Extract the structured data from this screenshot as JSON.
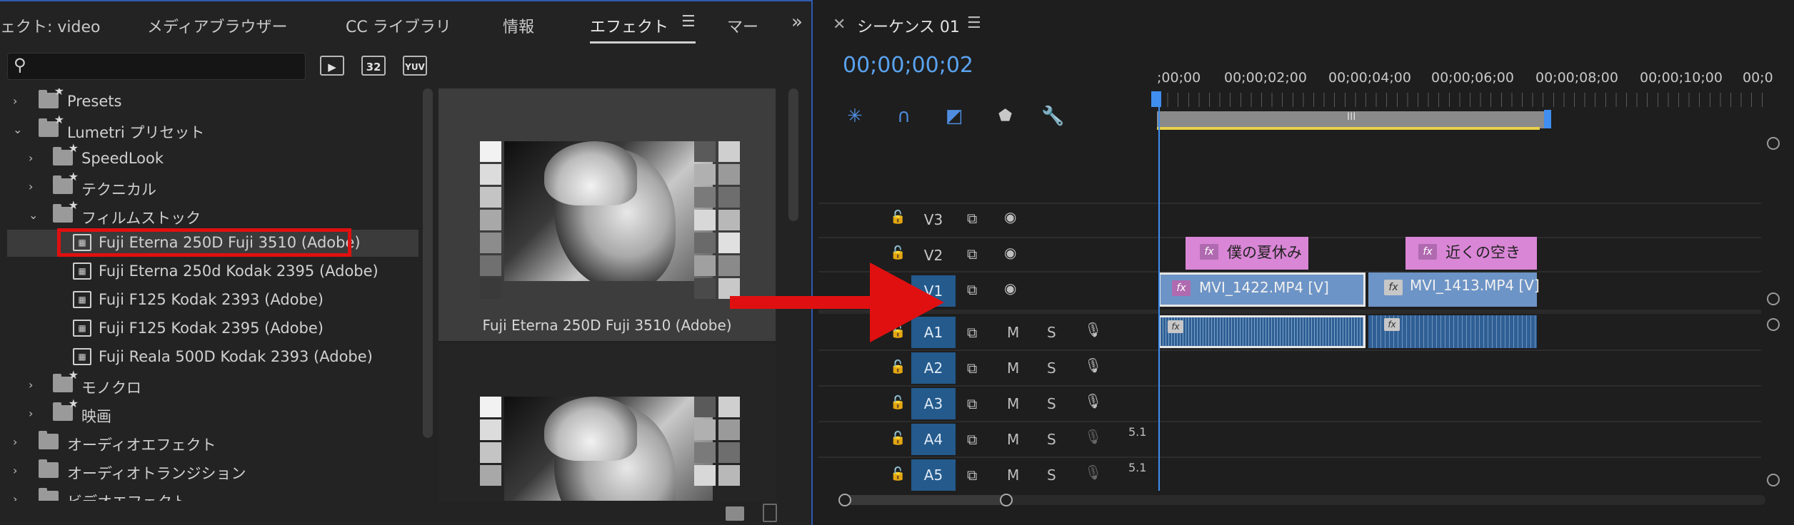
{
  "left_panel": {
    "tabs": [
      {
        "label": "ェクト: video"
      },
      {
        "label": "メディアブラウザー"
      },
      {
        "label": "CC ライブラリ"
      },
      {
        "label": "情報"
      },
      {
        "label": "エフェクト"
      },
      {
        "label": "マー"
      }
    ],
    "active_tab": "エフェクト",
    "tab_menu_icon": "hamburger-icon",
    "overflow_icon": "double-chevron-right-icon",
    "search": {
      "value": "",
      "placeholder": ""
    },
    "filter_buttons": [
      {
        "label": "",
        "icon": "accelerated-effects-icon"
      },
      {
        "label": "32",
        "icon": "32bit-icon"
      },
      {
        "label": "YUV",
        "icon": "yuv-icon"
      }
    ],
    "tree": [
      {
        "label": "Presets",
        "type": "preset-folder",
        "indent": 0,
        "expanded": false
      },
      {
        "label": "Lumetri プリセット",
        "type": "preset-folder",
        "indent": 0,
        "expanded": true
      },
      {
        "label": "SpeedLook",
        "type": "preset-folder",
        "indent": 1,
        "expanded": false
      },
      {
        "label": "テクニカル",
        "type": "preset-folder",
        "indent": 1,
        "expanded": false
      },
      {
        "label": "フィルムストック",
        "type": "preset-folder",
        "indent": 1,
        "expanded": true
      },
      {
        "label": "Fuji Eterna 250D Fuji 3510 (Adobe)",
        "type": "preset",
        "indent": 2,
        "selected": true
      },
      {
        "label": "Fuji Eterna 250d Kodak 2395 (Adobe)",
        "type": "preset",
        "indent": 2
      },
      {
        "label": "Fuji F125 Kodak 2393 (Adobe)",
        "type": "preset",
        "indent": 2
      },
      {
        "label": "Fuji F125 Kodak 2395 (Adobe)",
        "type": "preset",
        "indent": 2
      },
      {
        "label": "Fuji Reala 500D Kodak 2393 (Adobe)",
        "type": "preset",
        "indent": 2
      },
      {
        "label": "モノクロ",
        "type": "preset-folder",
        "indent": 1,
        "expanded": false
      },
      {
        "label": "映画",
        "type": "preset-folder",
        "indent": 1,
        "expanded": false
      },
      {
        "label": "オーディオエフェクト",
        "type": "folder",
        "indent": 0,
        "expanded": false
      },
      {
        "label": "オーディオトランジション",
        "type": "folder",
        "indent": 0,
        "expanded": false
      },
      {
        "label": "ビデオエフェクト",
        "type": "folder",
        "indent": 0,
        "expanded": false
      }
    ],
    "preview_label": "Fuji Eterna 250D Fuji 3510 (Adobe)",
    "highlight_color": "#e01010"
  },
  "timeline": {
    "close_icon": "close-icon",
    "title": "シーケンス 01",
    "menu_icon": "hamburger-icon",
    "timecode": "00;00;00;02",
    "timecode_color": "#5aa3f0",
    "tools": [
      {
        "icon": "snap-nest-icon"
      },
      {
        "icon": "magnet-snap-icon"
      },
      {
        "icon": "linked-selection-icon"
      },
      {
        "icon": "add-marker-icon"
      },
      {
        "icon": "wrench-settings-icon"
      }
    ],
    "ruler": [
      ";00;00",
      "00;00;02;00",
      "00;00;04;00",
      "00;00;06;00",
      "00;00;08;00",
      "00;00;10;00",
      "00;0"
    ],
    "work_area_handle_label": "III",
    "video_tracks": [
      {
        "name": "V3",
        "target": false
      },
      {
        "name": "V2",
        "target": false
      },
      {
        "name": "V1",
        "target": true
      }
    ],
    "audio_tracks": [
      {
        "name": "A1",
        "mute": "M",
        "solo": "S",
        "channel": ""
      },
      {
        "name": "A2",
        "mute": "M",
        "solo": "S",
        "channel": ""
      },
      {
        "name": "A3",
        "mute": "M",
        "solo": "S",
        "channel": ""
      },
      {
        "name": "A4",
        "mute": "M",
        "solo": "S",
        "channel": "5.1"
      },
      {
        "name": "A5",
        "mute": "M",
        "solo": "S",
        "channel": "5.1"
      }
    ],
    "clips_v2": [
      {
        "fx": "fx",
        "name": "僕の夏休み"
      },
      {
        "fx": "fx",
        "name": "近くの空き"
      }
    ],
    "clips_v1": [
      {
        "fx": "fx",
        "name": "MVI_1422.MP4 [V]"
      },
      {
        "fx": "fx",
        "name": "MVI_1413.MP4 [V]"
      }
    ],
    "clips_a1": [
      {
        "fx": "fx"
      },
      {
        "fx": "fx"
      }
    ]
  }
}
